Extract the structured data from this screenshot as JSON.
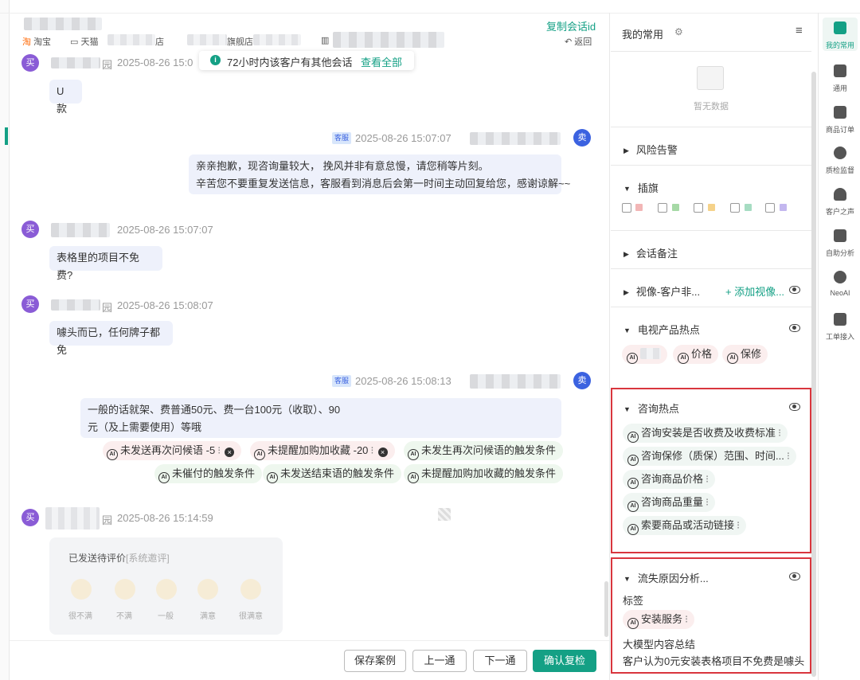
{
  "header": {
    "copy_session_id": "复制会话id",
    "back": "返回",
    "shops": [
      "淘宝",
      "天猫",
      "店",
      "旗舰店"
    ]
  },
  "notice": {
    "text": "72小时内该客户有其他会话",
    "link": "查看全部"
  },
  "messages": [
    {
      "role": "buyer",
      "avatar": "买",
      "name_suffix": "园",
      "time": "2025-08-26 15:0",
      "text": "U 款"
    },
    {
      "role": "seller",
      "avatar": "卖",
      "badge": "客服",
      "time": "2025-08-26 15:07:07",
      "lines": [
        "亲亲抱歉，现咨询量较大， 挽风并非有意怠慢，请您稍等片刻。",
        "辛苦您不要重复发送信息，客服看到消息后会第一时间主动回复给您，感谢谅解~~"
      ]
    },
    {
      "role": "buyer",
      "avatar": "买",
      "time": "2025-08-26 15:07:07",
      "text": "表格里的项目不免费?"
    },
    {
      "role": "buyer",
      "avatar": "买",
      "name_suffix": "园",
      "time": "2025-08-26 15:08:07",
      "text": "噱头而已，任何牌子都免"
    },
    {
      "role": "seller",
      "avatar": "卖",
      "badge": "客服",
      "time": "2025-08-26 15:08:13",
      "lines": [
        "一般的话就架、费普通50元、费一台100元（收取）、90",
        "元（及上需要使用）等哦"
      ]
    },
    {
      "role": "buyer",
      "avatar": "买",
      "name_suffix": "园",
      "time": "2025-08-26 15:14:59"
    }
  ],
  "qc_tags": {
    "red": [
      {
        "label": "未发送再次问候语 -5"
      },
      {
        "label": "未提醒加购加收藏 -20"
      }
    ],
    "green": [
      "未发生再次问候语的触发条件",
      "未催付的触发条件",
      "未发送结束语的触发条件",
      "未提醒加购加收藏的触发条件"
    ]
  },
  "rating_card": {
    "title": "已发送待评价",
    "system": "[系统邀评]",
    "options": [
      "很不满",
      "不满",
      "一般",
      "满意",
      "很满意"
    ]
  },
  "footer": {
    "save_case": "保存案例",
    "prev": "上一通",
    "next": "下一通",
    "confirm": "确认复检"
  },
  "panel": {
    "title": "我的常用",
    "empty": "暂无数据",
    "sections": {
      "risk": "风险告警",
      "flag": "插旗",
      "note": "会话备注",
      "video": "视像-客户非...",
      "video_add": "+ 添加视像...",
      "tv": "电视产品热点",
      "consult": "咨询热点",
      "churn": "流失原因分析..."
    },
    "tv_tags": [
      "价格",
      "保修"
    ],
    "consult_tags": [
      "咨询安装是否收费及收费标准",
      "咨询保修（质保）范围、时间...",
      "咨询商品价格",
      "咨询商品重量",
      "索要商品或活动链接"
    ],
    "churn": {
      "tag_heading": "标签",
      "tag": "安装服务",
      "summary_heading": "大模型内容总结",
      "summary": "客户认为0元安装表格项目不免费是噱头"
    },
    "flag_colors": [
      "#f2b6b6",
      "#a6d9a6",
      "#f5d28a",
      "#a6dcc2",
      "#c3b7ef"
    ]
  },
  "nav": [
    {
      "label": "我的常用",
      "icon": "grid-icon"
    },
    {
      "label": "通用",
      "icon": "chat-icon"
    },
    {
      "label": "商品订单",
      "icon": "clipboard-icon"
    },
    {
      "label": "质检监督",
      "icon": "shield-icon"
    },
    {
      "label": "客户之声",
      "icon": "user-voice-icon"
    },
    {
      "label": "自助分析",
      "icon": "chart-icon"
    },
    {
      "label": "NeoAI",
      "icon": "brain-icon"
    },
    {
      "label": "工单接入",
      "icon": "ticket-icon"
    }
  ],
  "colors": {
    "accent": "#14a085",
    "buyer": "#8a5cd6",
    "seller": "#3b62e0",
    "highlight": "#d9363e"
  }
}
